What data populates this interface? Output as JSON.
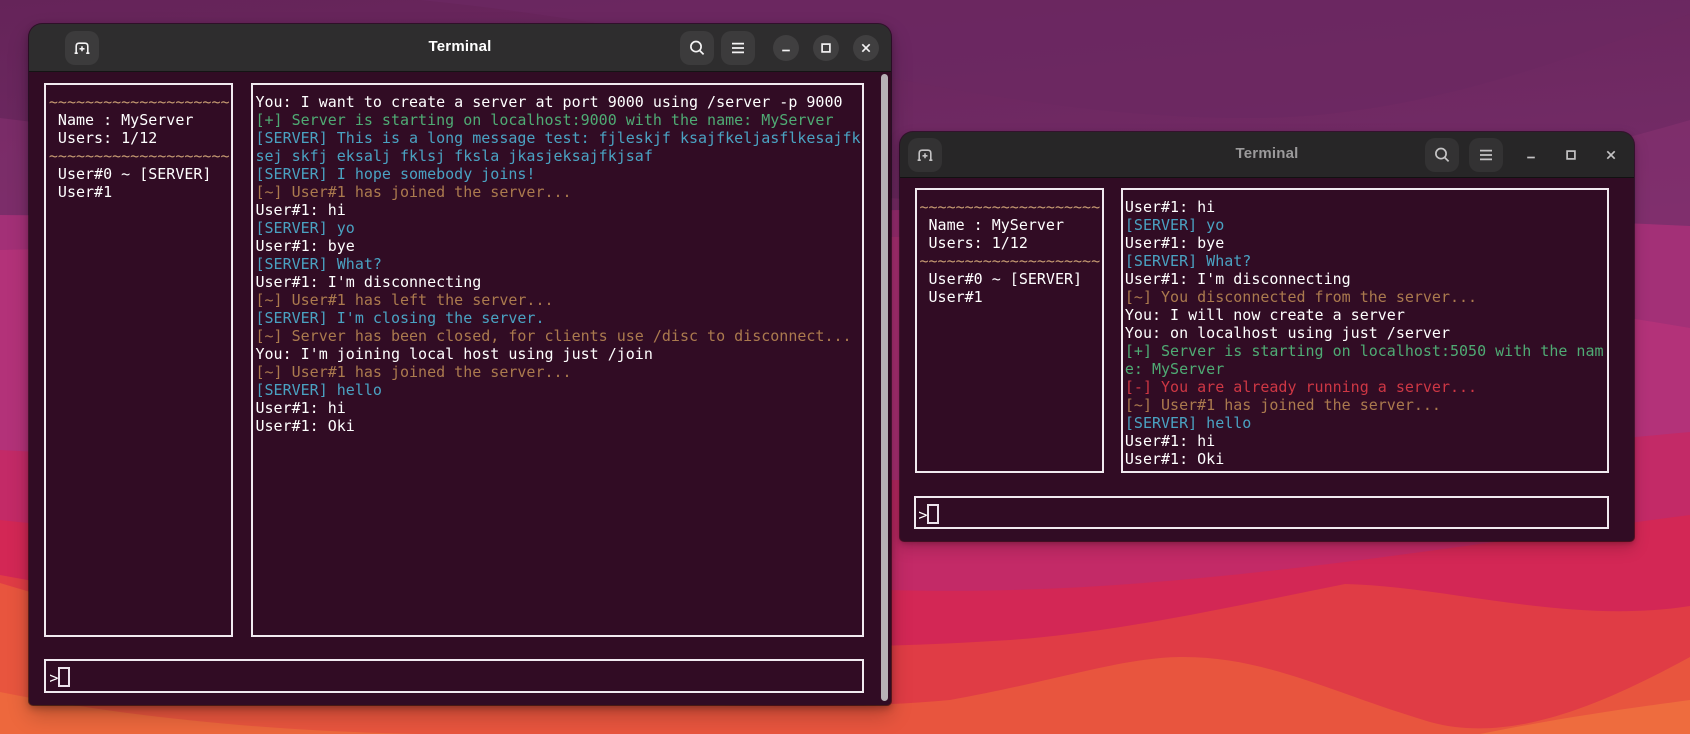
{
  "theme": {
    "terminal_background": "#310c24",
    "box_border": "#f1eaf0",
    "colors": {
      "default": "#ffffff",
      "success": "#4fab74",
      "server": "#4aa2c2",
      "system": "#ab7a4e",
      "error": "#ce3744",
      "divider": "#c89d73"
    },
    "wallpaper": {
      "purple_top": "#672459",
      "purple_light": "#7d3071",
      "magenta": "#a73077",
      "magenta_bright": "#b43178",
      "pink": "#c22a68",
      "crimson": "#d22754",
      "red": "#e23f45",
      "orange": "#e85a3d",
      "orange_light": "#ed6a3c"
    }
  },
  "windows": [
    {
      "title": "Terminal",
      "focused": true,
      "sidebar_lines": [
        {
          "text": "~~~~~~~~~~~~~~~~~~~~",
          "color": "divider"
        },
        {
          "text": " Name : MyServer",
          "color": "default"
        },
        {
          "text": " Users: 1/12",
          "color": "default"
        },
        {
          "text": "~~~~~~~~~~~~~~~~~~~~",
          "color": "divider"
        },
        {
          "text": " User#0 ~ [SERVER]",
          "color": "default"
        },
        {
          "text": " User#1",
          "color": "default"
        }
      ],
      "chat_lines": [
        {
          "text": "You: I want to create a server at port 9000 using /server -p 9000",
          "color": "default"
        },
        {
          "text": "[+] Server is starting on localhost:9000 with the name: MyServer",
          "color": "success"
        },
        {
          "text": "[SERVER] This is a long message test: fjleskjf ksajfkeljasflkesajfk",
          "color": "server"
        },
        {
          "text": "sej skfj eksalj fklsj fksla jkasjeksajfkjsaf",
          "color": "server"
        },
        {
          "text": "[SERVER] I hope somebody joins!",
          "color": "server"
        },
        {
          "text": "[~] User#1 has joined the server...",
          "color": "system"
        },
        {
          "text": "User#1: hi",
          "color": "default"
        },
        {
          "text": "[SERVER] yo",
          "color": "server"
        },
        {
          "text": "User#1: bye",
          "color": "default"
        },
        {
          "text": "[SERVER] What?",
          "color": "server"
        },
        {
          "text": "User#1: I'm disconnecting",
          "color": "default"
        },
        {
          "text": "[~] User#1 has left the server...",
          "color": "system"
        },
        {
          "text": "[SERVER] I'm closing the server.",
          "color": "server"
        },
        {
          "text": "[~] Server has been closed, for clients use /disc to disconnect...",
          "color": "system"
        },
        {
          "text": "You: I'm joining local host using just /join",
          "color": "default"
        },
        {
          "text": "[~] User#1 has joined the server...",
          "color": "system"
        },
        {
          "text": "[SERVER] hello",
          "color": "server"
        },
        {
          "text": "User#1: hi",
          "color": "default"
        },
        {
          "text": "User#1: Oki",
          "color": "default"
        }
      ],
      "input_prompt": ">"
    },
    {
      "title": "Terminal",
      "focused": false,
      "sidebar_lines": [
        {
          "text": "~~~~~~~~~~~~~~~~~~~~",
          "color": "divider"
        },
        {
          "text": " Name : MyServer",
          "color": "default"
        },
        {
          "text": " Users: 1/12",
          "color": "default"
        },
        {
          "text": "~~~~~~~~~~~~~~~~~~~~",
          "color": "divider"
        },
        {
          "text": " User#0 ~ [SERVER]",
          "color": "default"
        },
        {
          "text": " User#1",
          "color": "default"
        }
      ],
      "chat_lines": [
        {
          "text": "User#1: hi",
          "color": "default"
        },
        {
          "text": "[SERVER] yo",
          "color": "server"
        },
        {
          "text": "User#1: bye",
          "color": "default"
        },
        {
          "text": "[SERVER] What?",
          "color": "server"
        },
        {
          "text": "User#1: I'm disconnecting",
          "color": "default"
        },
        {
          "text": "[~] You disconnected from the server...",
          "color": "system"
        },
        {
          "text": "You: I will now create a server",
          "color": "default"
        },
        {
          "text": "You: on localhost using just /server",
          "color": "default"
        },
        {
          "text": "[+] Server is starting on localhost:5050 with the nam",
          "color": "success"
        },
        {
          "text": "e: MyServer",
          "color": "success"
        },
        {
          "text": "[-] You are already running a server...",
          "color": "error"
        },
        {
          "text": "[~] User#1 has joined the server...",
          "color": "system"
        },
        {
          "text": "[SERVER] hello",
          "color": "server"
        },
        {
          "text": "User#1: hi",
          "color": "default"
        },
        {
          "text": "User#1: Oki",
          "color": "default"
        }
      ],
      "input_prompt": ">"
    }
  ]
}
